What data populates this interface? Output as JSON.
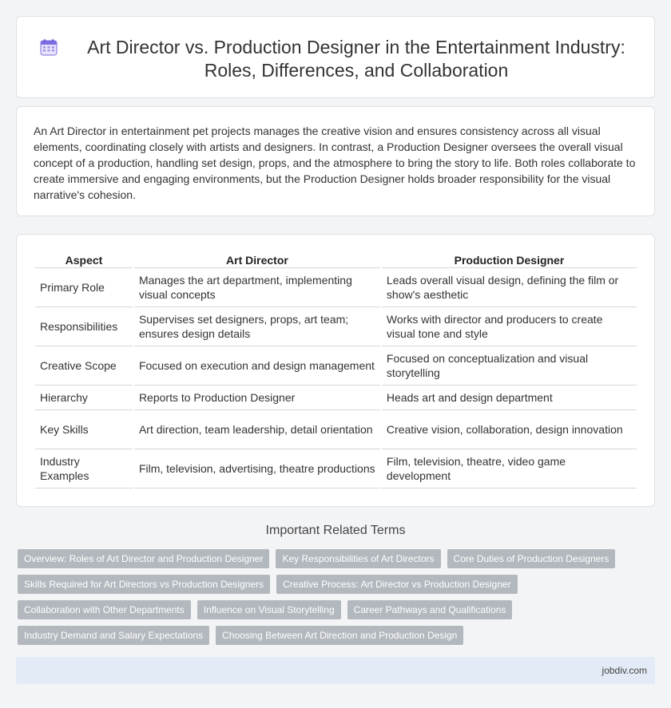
{
  "header": {
    "icon": "calendar-icon",
    "title": "Art Director vs. Production Designer in the Entertainment Industry: Roles, Differences, and Collaboration"
  },
  "intro": "An Art Director in entertainment pet projects manages the creative vision and ensures consistency across all visual elements, coordinating closely with artists and designers. In contrast, a Production Designer oversees the overall visual concept of a production, handling set design, props, and the atmosphere to bring the story to life. Both roles collaborate to create immersive and engaging environments, but the Production Designer holds broader responsibility for the visual narrative's cohesion.",
  "table": {
    "headers": [
      "Aspect",
      "Art Director",
      "Production Designer"
    ],
    "rows": [
      [
        "Primary Role",
        "Manages the art department, implementing visual concepts",
        "Leads overall visual design, defining the film or show's aesthetic"
      ],
      [
        "Responsibilities",
        "Supervises set designers, props, art team; ensures design details",
        "Works with director and producers to create visual tone and style"
      ],
      [
        "Creative Scope",
        "Focused on execution and design management",
        "Focused on conceptualization and visual storytelling"
      ],
      [
        "Hierarchy",
        "Reports to Production Designer",
        "Heads art and design department"
      ],
      [
        "Key Skills",
        "Art direction, team leadership, detail orientation",
        "Creative vision, collaboration, design innovation"
      ],
      [
        "Industry Examples",
        "Film, television, advertising, theatre productions",
        "Film, television, theatre, video game development"
      ]
    ]
  },
  "related": {
    "title": "Important Related Terms",
    "tags": [
      [
        "Overview: Roles of Art Director and Production Designer",
        "Key Responsibilities of Art Directors",
        "Core Duties of Production Designers"
      ],
      [
        "Skills Required for Art Directors vs Production Designers",
        "Creative Process: Art Director vs Production Designer"
      ],
      [
        "Collaboration with Other Departments",
        "Influence on Visual Storytelling",
        "Career Pathways and Qualifications"
      ],
      [
        "Industry Demand and Salary Expectations",
        "Choosing Between Art Direction and Production Design"
      ]
    ]
  },
  "footer": {
    "site": "jobdiv.com"
  },
  "colors": {
    "tag_bg": "#b3b8be",
    "footer_bg": "#e3ebf6",
    "page_bg": "#f3f4f6",
    "icon_accent": "#7b6ee0"
  }
}
